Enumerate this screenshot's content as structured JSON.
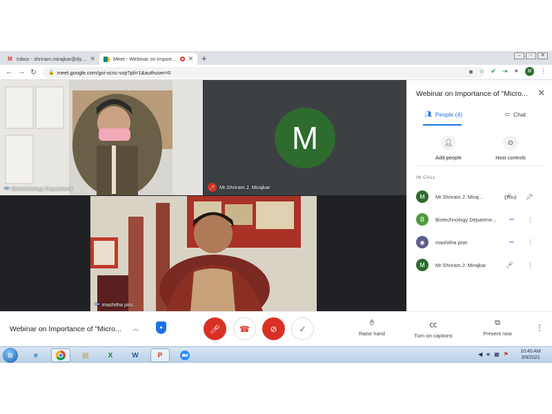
{
  "browser": {
    "tabs": [
      {
        "title": "Inbox - shriram.mirajkar@dypvp...",
        "icon": "gmail-icon"
      },
      {
        "title": "Meet - Webinar on Importa...",
        "icon": "meet-icon"
      }
    ],
    "address": "meet.google.com/goi-xcnc-vvp?pli=1&authuser=0",
    "profile_initial": "M"
  },
  "tiles": [
    {
      "label": "Biotechnology Department"
    },
    {
      "label": "Mr.Shriram.J. Mirajkar",
      "avatar": "M"
    },
    {
      "label": "mashitha pisc"
    }
  ],
  "panel": {
    "title": "Webinar on Importance of \"Micro...",
    "tab_people": "People (4)",
    "tab_chat": "Chat",
    "add_people": "Add people",
    "host_controls": "Host controls",
    "in_call": "IN CALL",
    "participants": [
      {
        "initial": "M",
        "name": "Mr.Shriram.J. Miraj...",
        "tag": "(You)",
        "color": "#2e6b2e"
      },
      {
        "initial": "B",
        "name": "Biotechnology Departme...",
        "tag": "",
        "color": "#4f9a3a"
      },
      {
        "initial": "",
        "name": "mashitha pise",
        "tag": "",
        "color": "#5b5f8a"
      },
      {
        "initial": "M",
        "name": "Mr.Shriram.J. Mirajkar",
        "tag": "",
        "color": "#2e6b2e"
      }
    ]
  },
  "bottom": {
    "meeting_title": "Webinar on Importance of \"Micro...",
    "raise_hand": "Raise hand",
    "captions": "Turn on captions",
    "present": "Present now"
  },
  "taskbar": {
    "time": "10:40 AM",
    "date": "3/9/2021"
  },
  "colors": {
    "accent": "#1a73e8",
    "danger": "#d93025",
    "avatar_green": "#2e6b2e"
  }
}
